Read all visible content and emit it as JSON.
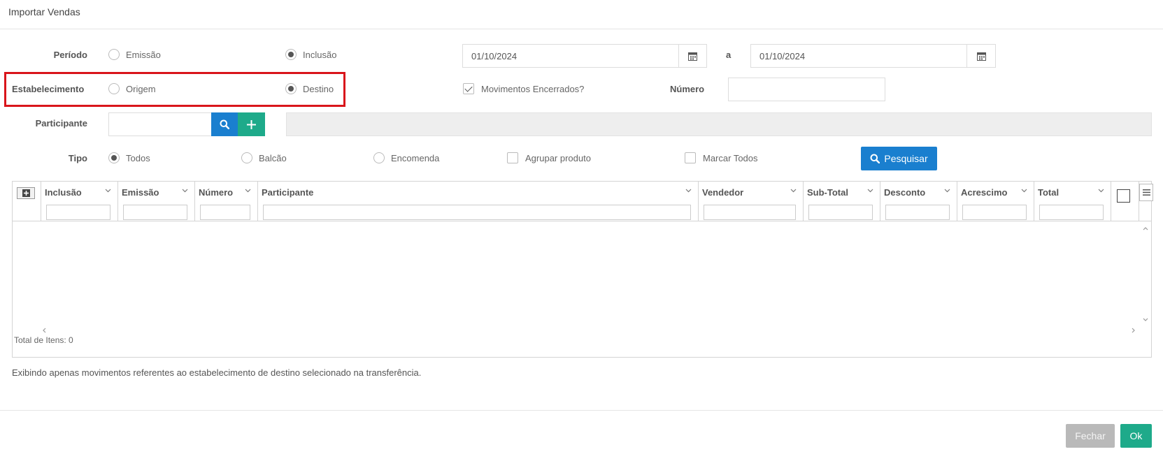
{
  "dialog": {
    "title": "Importar Vendas"
  },
  "periodo": {
    "label": "Período",
    "options": [
      "Emissão",
      "Inclusão"
    ],
    "selected": "Inclusão",
    "date_from": "01/10/2024",
    "separator": "a",
    "date_to": "01/10/2024"
  },
  "estabelecimento": {
    "label": "Estabelecimento",
    "options": [
      "Origem",
      "Destino"
    ],
    "selected": "Destino"
  },
  "movimentos_encerrados": {
    "label": "Movimentos Encerrados?",
    "checked": true
  },
  "numero": {
    "label": "Número",
    "value": ""
  },
  "participante": {
    "label": "Participante",
    "value": ""
  },
  "tipo": {
    "label": "Tipo",
    "options": [
      "Todos",
      "Balcão",
      "Encomenda"
    ],
    "selected": "Todos"
  },
  "agrupar_produto": {
    "label": "Agrupar produto",
    "checked": false
  },
  "marcar_todos": {
    "label": "Marcar Todos",
    "checked": false
  },
  "pesquisar": {
    "label": "Pesquisar"
  },
  "grid": {
    "columns": [
      "Inclusão",
      "Emissão",
      "Número",
      "Participante",
      "Vendedor",
      "Sub-Total",
      "Desconto",
      "Acrescimo",
      "Total"
    ],
    "rows": [],
    "total_itens": "Total de Itens: 0"
  },
  "info_text": "Exibindo apenas movimentos referentes ao estabelecimento de destino selecionado na transferência.",
  "footer": {
    "fechar": "Fechar",
    "ok": "Ok"
  },
  "colors": {
    "primary": "#1a7fcf",
    "success": "#1eaa8a",
    "highlight": "#d9151b",
    "disabled": "#b9b9b9"
  }
}
